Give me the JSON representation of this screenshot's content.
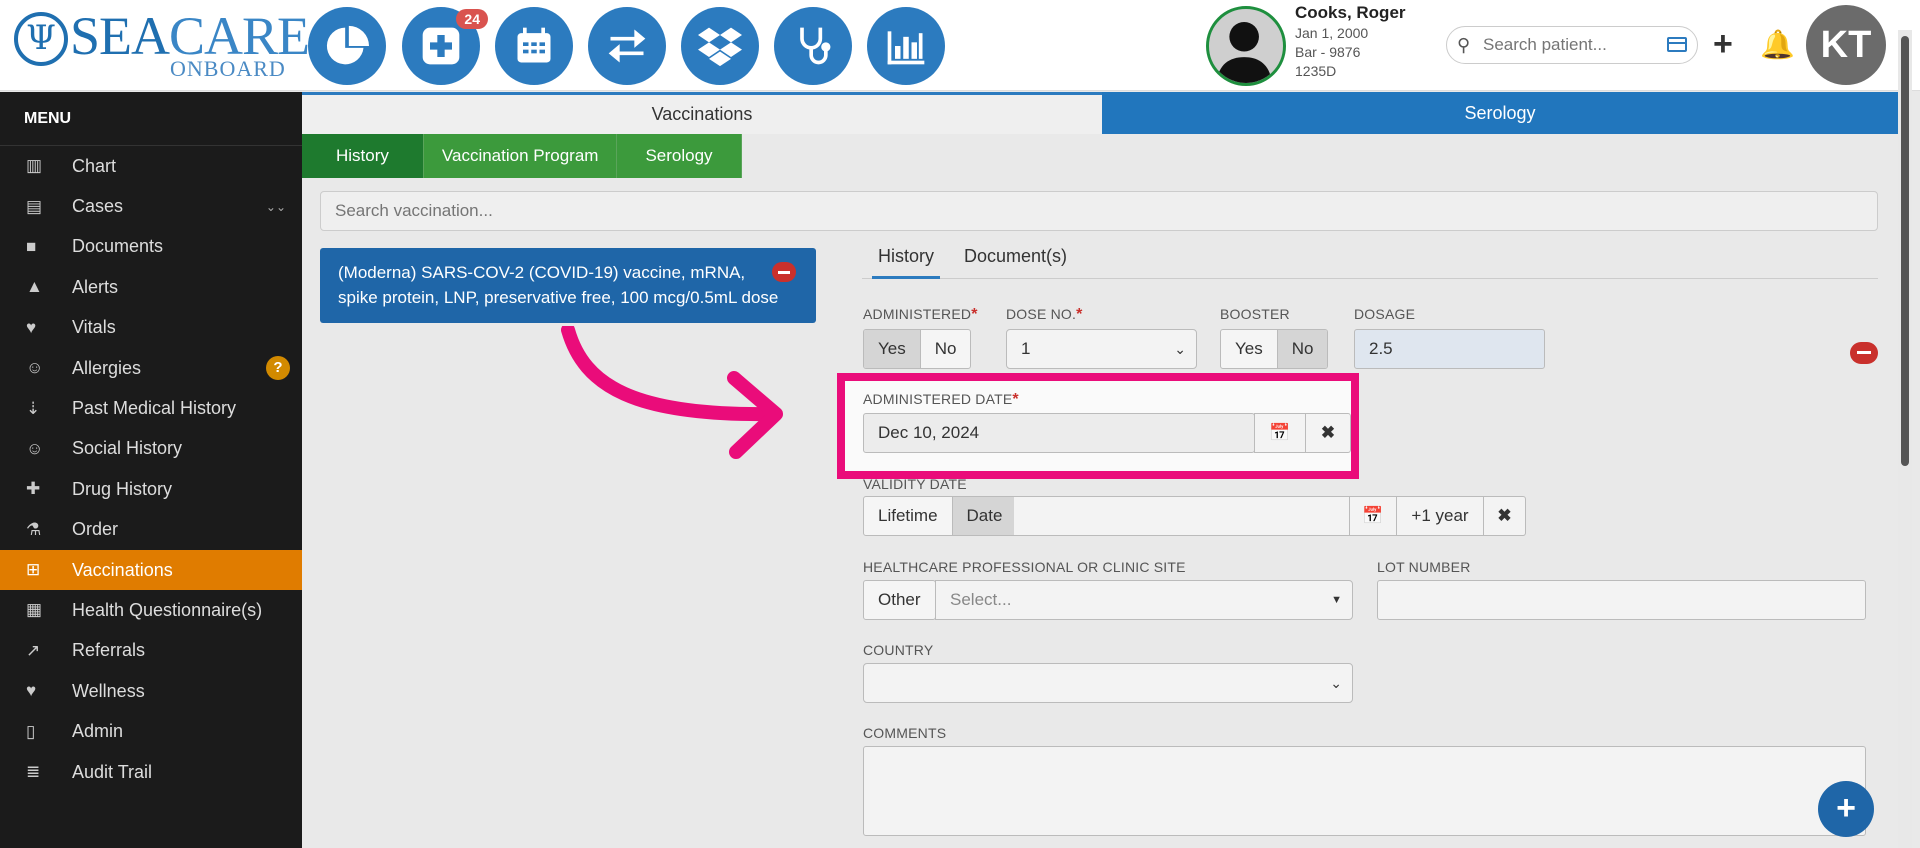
{
  "header": {
    "logo_line1_a": "SEA",
    "logo_line1_b": "CARE",
    "logo_line2": "ONBOARD",
    "nav": [
      {
        "icon": "pie-chart-icon"
      },
      {
        "icon": "medical-plus-icon",
        "badge": "24"
      },
      {
        "icon": "calendar-icon"
      },
      {
        "icon": "transfer-arrows-icon"
      },
      {
        "icon": "dropbox-icon"
      },
      {
        "icon": "stethoscope-icon"
      },
      {
        "icon": "bar-chart-icon"
      }
    ],
    "patient": {
      "name": "Cooks, Roger",
      "dob": "Jan 1, 2000",
      "line2": "Bar - 9876",
      "line3": "1235D"
    },
    "search_placeholder": "Search patient...",
    "avatar_initials": "KT"
  },
  "sidebar": {
    "title": "MENU",
    "items": [
      {
        "label": "Chart",
        "icon": "chart-icon"
      },
      {
        "label": "Cases",
        "icon": "archive-icon"
      },
      {
        "label": "Documents",
        "icon": "folder-icon"
      },
      {
        "label": "Alerts",
        "icon": "warning-icon"
      },
      {
        "label": "Vitals",
        "icon": "heart-icon"
      },
      {
        "label": "Allergies",
        "icon": "smiley-icon",
        "badge": "?"
      },
      {
        "label": "Past Medical History",
        "icon": "sort-icon"
      },
      {
        "label": "Social History",
        "icon": "smiley-icon"
      },
      {
        "label": "Drug History",
        "icon": "medkit-icon"
      },
      {
        "label": "Order",
        "icon": "flask-icon"
      },
      {
        "label": "Vaccinations",
        "icon": "plus-square-icon",
        "active": true
      },
      {
        "label": "Health Questionnaire(s)",
        "icon": "form-icon"
      },
      {
        "label": "Referrals",
        "icon": "share-icon"
      },
      {
        "label": "Wellness",
        "icon": "heartbeat-icon"
      },
      {
        "label": "Admin",
        "icon": "file-icon"
      },
      {
        "label": "Audit Trail",
        "icon": "list-icon"
      }
    ]
  },
  "main": {
    "top_tabs": [
      "Vaccinations",
      "Serology"
    ],
    "sub_tabs": [
      "History",
      "Vaccination Program",
      "Serology"
    ],
    "search_placeholder": "Search vaccination...",
    "vaccine_card": "(Moderna) SARS-COV-2 (COVID-19) vaccine, mRNA, spike protein, LNP, preservative free, 100 mcg/0.5mL dose",
    "detail_tabs": [
      "History",
      "Document(s)"
    ],
    "form": {
      "administered_label": "ADMINISTERED",
      "yes": "Yes",
      "no": "No",
      "dose_label": "DOSE NO.",
      "dose_value": "1",
      "booster_label": "BOOSTER",
      "dosage_label": "DOSAGE",
      "dosage_value": "2.5",
      "administered_date_label": "ADMINISTERED DATE",
      "administered_date_value": "Dec 10, 2024",
      "validity_label": "VALIDITY DATE",
      "lifetime": "Lifetime",
      "date": "Date",
      "plus_year": "+1 year",
      "hcp_label": "HEALTHCARE PROFESSIONAL OR CLINIC SITE",
      "other": "Other",
      "select_placeholder": "Select...",
      "lot_label": "LOT NUMBER",
      "country_label": "COUNTRY",
      "comments_label": "COMMENTS"
    }
  },
  "colors": {
    "brand_blue": "#2c7bbf",
    "active_orange": "#e07c00",
    "highlight_pink": "#ea0c7a",
    "green_tab": "#3c9a3c"
  }
}
